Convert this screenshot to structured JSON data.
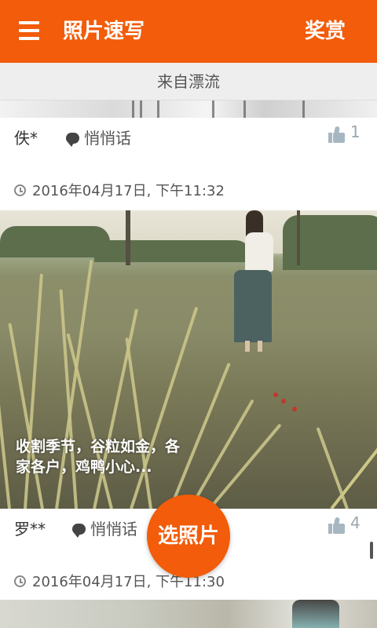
{
  "app_bar": {
    "title": "照片速写",
    "reward_label": "奖赏",
    "background": "#f25c0a",
    "menu_icon": "hamburger-menu-icon"
  },
  "source_bar": {
    "label": "来自漂流"
  },
  "posts": [
    {
      "username": "佚*",
      "whisper_label": "悄悄话",
      "like_count": "1",
      "timestamp": "2016年04月17日, 下午11:32",
      "caption": "收割季节，谷粒如金，各家各户，鸡鸭小心..."
    },
    {
      "username": "罗**",
      "whisper_label": "悄悄话",
      "like_count": "4",
      "timestamp": "2016年04月17日, 下午11:30"
    }
  ],
  "fab": {
    "label": "选照片"
  }
}
